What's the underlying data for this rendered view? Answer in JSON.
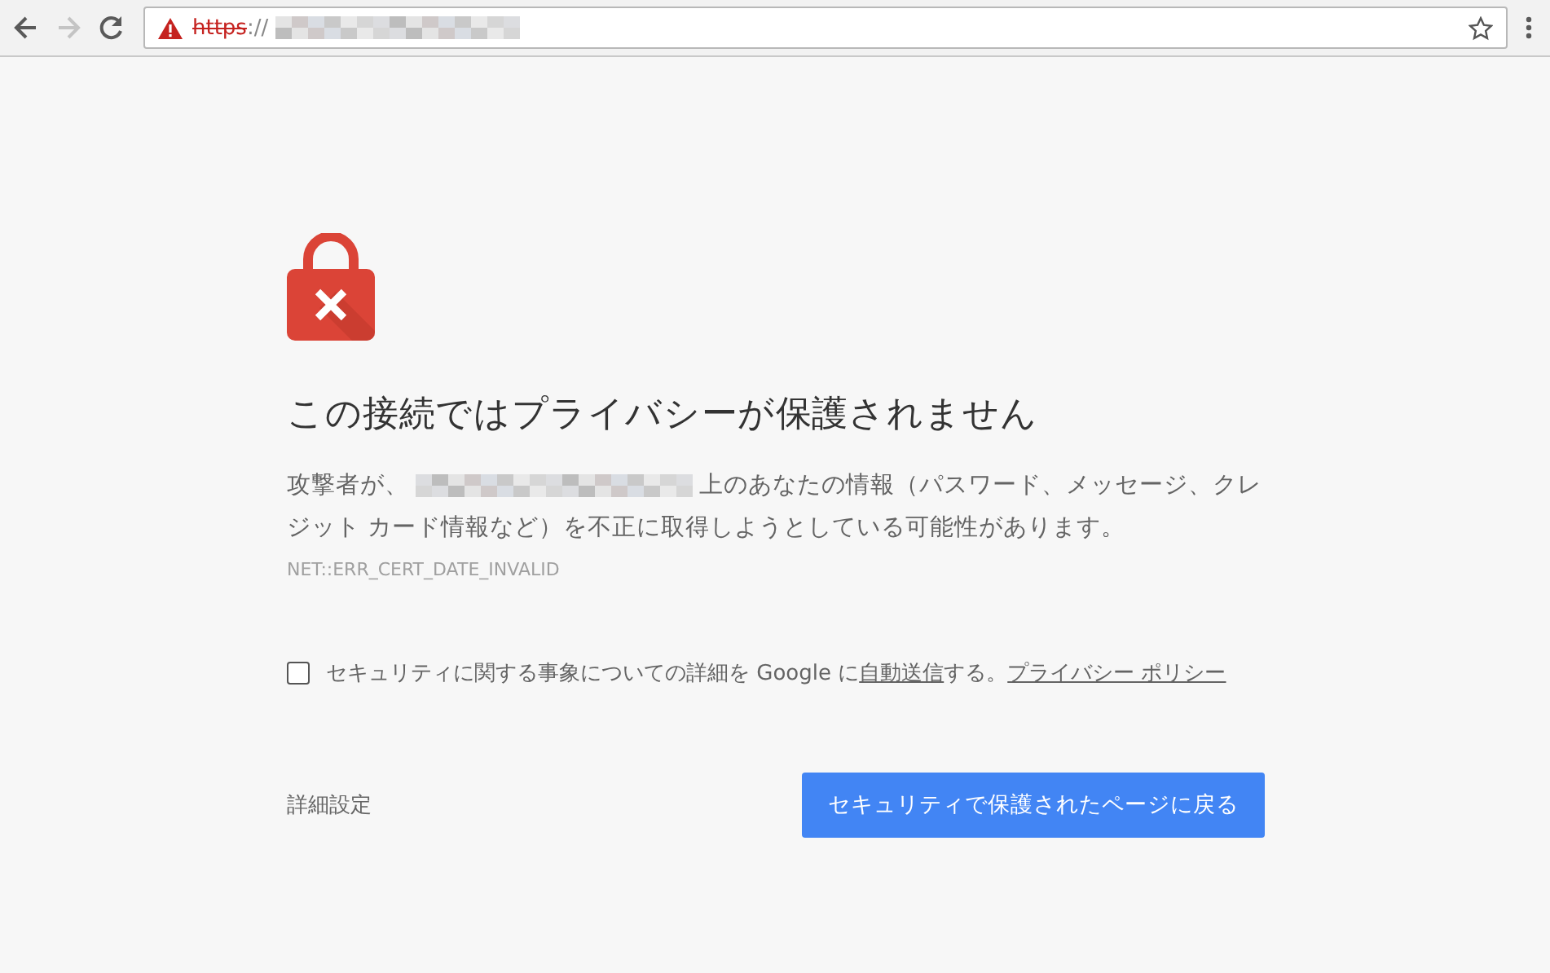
{
  "toolbar": {
    "address": {
      "insecure": true,
      "scheme": "https",
      "separator": "://"
    },
    "forward_disabled": true
  },
  "page": {
    "title": "この接続ではプライバシーが保護されません",
    "message_before": "攻撃者が、",
    "message_lines": [
      "上のあなたの情報（パスワード、メッセージ、クレ",
      "ジット カード情報など）を不正に取得しようとしている可能性があります。"
    ],
    "error_code": "NET::ERR_CERT_DATE_INVALID",
    "report": {
      "checked": false,
      "text_before": "セキュリティに関する事象についての詳細を Google に",
      "link": "自動送信",
      "text_after": "する。",
      "policy_link": "プライバシー ポリシー"
    },
    "advanced_link": "詳細設定",
    "back_button": "セキュリティで保護されたページに戻る"
  }
}
